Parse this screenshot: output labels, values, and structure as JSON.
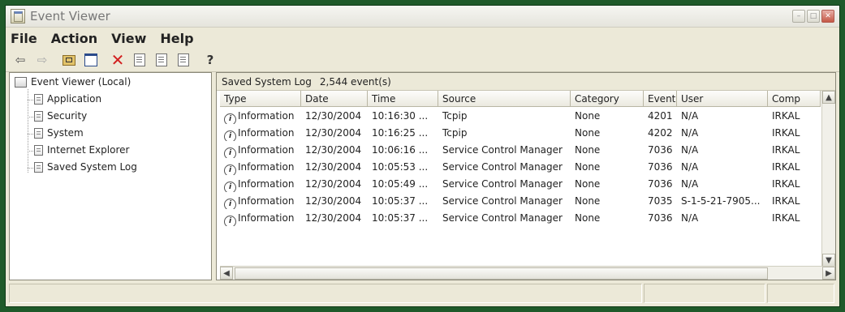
{
  "window": {
    "title": "Event Viewer",
    "app_icon": "event-viewer-icon"
  },
  "menubar": {
    "items": [
      "File",
      "Action",
      "View",
      "Help"
    ]
  },
  "toolbar": {
    "icons": [
      "back-arrow-icon",
      "forward-arrow-icon",
      "up-folder-icon",
      "show-hide-tree-icon",
      "delete-icon",
      "properties-icon",
      "refresh-icon",
      "export-list-icon",
      "help-icon"
    ]
  },
  "tree": {
    "root": "Event Viewer (Local)",
    "items": [
      "Application",
      "Security",
      "System",
      "Internet Explorer",
      "Saved System Log"
    ]
  },
  "summary": {
    "log_name": "Saved System Log",
    "event_count": "2,544 event(s)"
  },
  "table": {
    "columns": [
      "Type",
      "Date",
      "Time",
      "Source",
      "Category",
      "Event",
      "User",
      "Comp"
    ],
    "rows": [
      {
        "type": "Information",
        "date": "12/30/2004",
        "time": "10:16:30 ...",
        "source": "Tcpip",
        "category": "None",
        "event": "4201",
        "user": "N/A",
        "computer": "IRKAL"
      },
      {
        "type": "Information",
        "date": "12/30/2004",
        "time": "10:16:25 ...",
        "source": "Tcpip",
        "category": "None",
        "event": "4202",
        "user": "N/A",
        "computer": "IRKAL"
      },
      {
        "type": "Information",
        "date": "12/30/2004",
        "time": "10:06:16 ...",
        "source": "Service Control Manager",
        "category": "None",
        "event": "7036",
        "user": "N/A",
        "computer": "IRKAL"
      },
      {
        "type": "Information",
        "date": "12/30/2004",
        "time": "10:05:53 ...",
        "source": "Service Control Manager",
        "category": "None",
        "event": "7036",
        "user": "N/A",
        "computer": "IRKAL"
      },
      {
        "type": "Information",
        "date": "12/30/2004",
        "time": "10:05:49 ...",
        "source": "Service Control Manager",
        "category": "None",
        "event": "7036",
        "user": "N/A",
        "computer": "IRKAL"
      },
      {
        "type": "Information",
        "date": "12/30/2004",
        "time": "10:05:37 ...",
        "source": "Service Control Manager",
        "category": "None",
        "event": "7035",
        "user": "S-1-5-21-7905...",
        "computer": "IRKAL"
      },
      {
        "type": "Information",
        "date": "12/30/2004",
        "time": "10:05:37 ...",
        "source": "Service Control Manager",
        "category": "None",
        "event": "7036",
        "user": "N/A",
        "computer": "IRKAL"
      }
    ]
  }
}
